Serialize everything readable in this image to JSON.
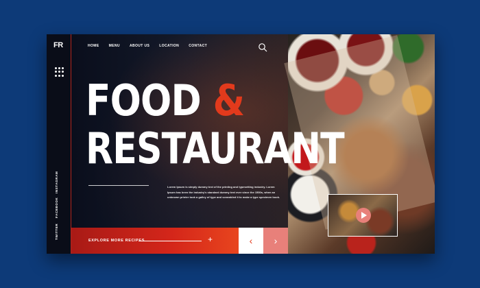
{
  "brand": {
    "logo": "FR"
  },
  "nav": {
    "items": [
      "HOME",
      "MENU",
      "ABOUT US",
      "LOCATION",
      "CONTACT"
    ]
  },
  "hero": {
    "title_line1_word": "FOOD",
    "title_line1_amp": "&",
    "title_line2": "RESTAURANT",
    "intro": "Lorem Ipsum is simply dummy text of the printing and typesetting industry. Lorem Ipsum has been the industry's standard dummy text ever since the 1500s, when an unknown printer took a galley of type and scrambled it to make a type specimen book."
  },
  "social": [
    "INSTAGRAM",
    "FACEBOOK",
    "TWITTER"
  ],
  "cta": {
    "label": "EXPLORE MORE RECIPES",
    "plus": "+"
  },
  "carousel": {
    "prev": "‹",
    "next": "›"
  },
  "colors": {
    "page_bg": "#0d3a78",
    "accent_red": "#e23a1c",
    "next_button": "#e8807a",
    "dark_panel": "#0b0f1e"
  },
  "icons": [
    "grid-menu-icon",
    "search-icon",
    "play-icon"
  ]
}
